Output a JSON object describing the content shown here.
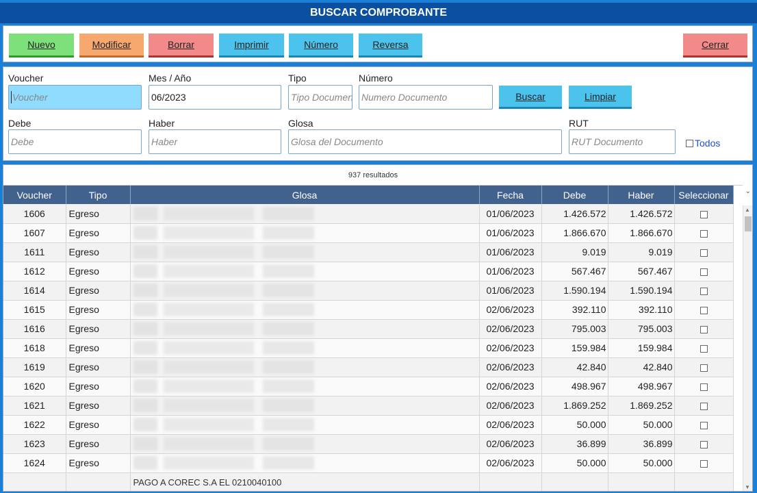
{
  "title": "BUSCAR COMPROBANTE",
  "toolbar": {
    "nuevo": "Nuevo",
    "modificar": "Modificar",
    "borrar": "Borrar",
    "imprimir": "Imprimir",
    "numero": "Número",
    "reversa": "Reversa",
    "cerrar": "Cerrar"
  },
  "filters": {
    "voucher": {
      "label": "Voucher",
      "placeholder": "Voucher",
      "value": ""
    },
    "mes": {
      "label": "Mes / Año",
      "value": "06/2023"
    },
    "tipo": {
      "label": "Tipo",
      "placeholder": "Tipo Documento",
      "value": ""
    },
    "numero": {
      "label": "Número",
      "placeholder": "Numero Documento",
      "value": ""
    },
    "buscar": "Buscar",
    "limpiar": "Limpiar",
    "debe": {
      "label": "Debe",
      "placeholder": "Debe",
      "value": ""
    },
    "haber": {
      "label": "Haber",
      "placeholder": "Haber",
      "value": ""
    },
    "glosa": {
      "label": "Glosa",
      "placeholder": "Glosa del Documento",
      "value": ""
    },
    "rut": {
      "label": "RUT",
      "placeholder": "RUT Documento",
      "value": ""
    },
    "todos": "Todos"
  },
  "results": {
    "count_text": "937 resultados",
    "columns": [
      "Voucher",
      "Tipo",
      "Glosa",
      "Fecha",
      "Debe",
      "Haber",
      "Seleccionar"
    ],
    "rows": [
      {
        "voucher": "1606",
        "tipo": "Egreso",
        "fecha": "01/06/2023",
        "debe": "1.426.572",
        "haber": "1.426.572"
      },
      {
        "voucher": "1607",
        "tipo": "Egreso",
        "fecha": "01/06/2023",
        "debe": "1.866.670",
        "haber": "1.866.670"
      },
      {
        "voucher": "1611",
        "tipo": "Egreso",
        "fecha": "01/06/2023",
        "debe": "9.019",
        "haber": "9.019"
      },
      {
        "voucher": "1612",
        "tipo": "Egreso",
        "fecha": "01/06/2023",
        "debe": "567.467",
        "haber": "567.467"
      },
      {
        "voucher": "1614",
        "tipo": "Egreso",
        "fecha": "01/06/2023",
        "debe": "1.590.194",
        "haber": "1.590.194"
      },
      {
        "voucher": "1615",
        "tipo": "Egreso",
        "fecha": "02/06/2023",
        "debe": "392.110",
        "haber": "392.110"
      },
      {
        "voucher": "1616",
        "tipo": "Egreso",
        "fecha": "02/06/2023",
        "debe": "795.003",
        "haber": "795.003"
      },
      {
        "voucher": "1618",
        "tipo": "Egreso",
        "fecha": "02/06/2023",
        "debe": "159.984",
        "haber": "159.984"
      },
      {
        "voucher": "1619",
        "tipo": "Egreso",
        "fecha": "02/06/2023",
        "debe": "42.840",
        "haber": "42.840"
      },
      {
        "voucher": "1620",
        "tipo": "Egreso",
        "fecha": "02/06/2023",
        "debe": "498.967",
        "haber": "498.967"
      },
      {
        "voucher": "1621",
        "tipo": "Egreso",
        "fecha": "02/06/2023",
        "debe": "1.869.252",
        "haber": "1.869.252"
      },
      {
        "voucher": "1622",
        "tipo": "Egreso",
        "fecha": "02/06/2023",
        "debe": "50.000",
        "haber": "50.000"
      },
      {
        "voucher": "1623",
        "tipo": "Egreso",
        "fecha": "02/06/2023",
        "debe": "36.899",
        "haber": "36.899"
      },
      {
        "voucher": "1624",
        "tipo": "Egreso",
        "fecha": "02/06/2023",
        "debe": "50.000",
        "haber": "50.000"
      }
    ],
    "partial_row_glosa": "PAGO A COREC S.A EL 0210040100"
  },
  "colors": {
    "title_bar": "#0b4fa0",
    "background": "#1a7fd6",
    "header": "#42628e",
    "active_input": "#8fdcff"
  }
}
